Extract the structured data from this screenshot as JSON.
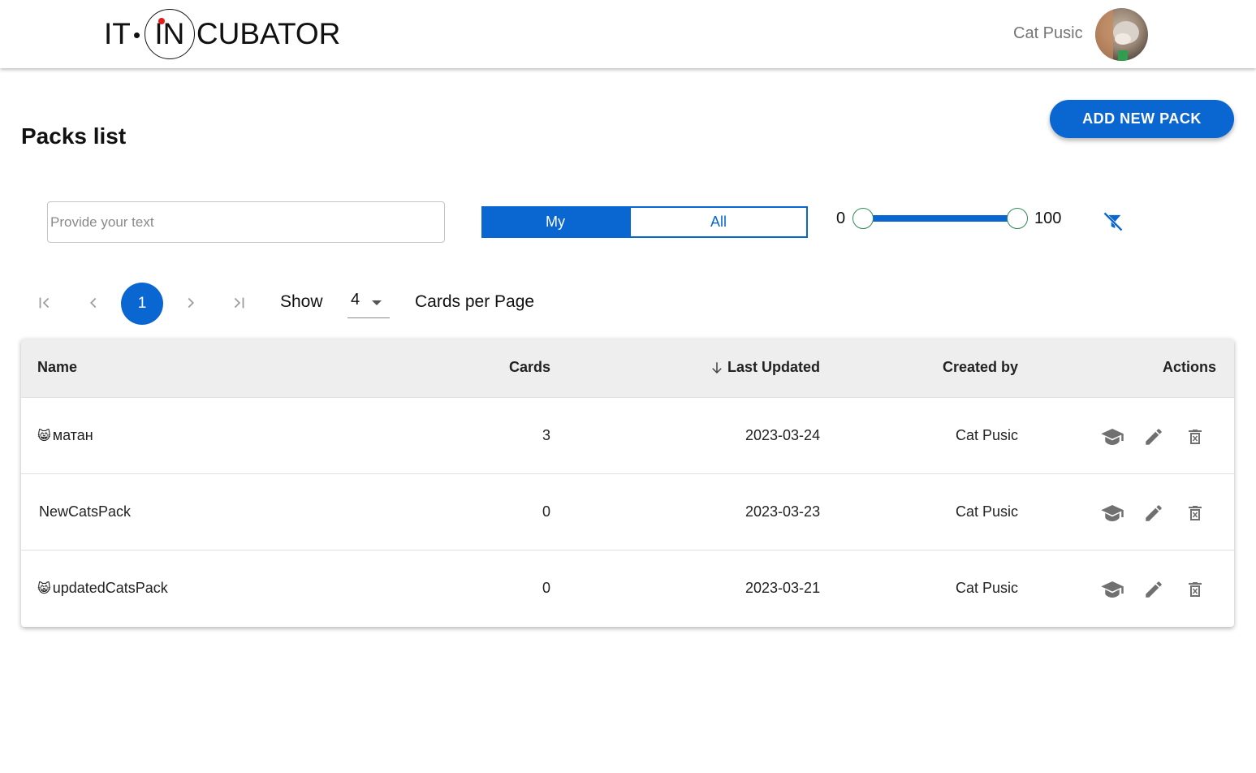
{
  "header": {
    "logo_left": "IT",
    "logo_mid": "IN",
    "logo_right": "CUBATOR",
    "user_name": "Cat Pusic"
  },
  "page": {
    "title": "Packs list",
    "add_button": "ADD NEW PACK"
  },
  "filters": {
    "search_placeholder": "Provide your text",
    "toggle_my": "My",
    "toggle_all": "All",
    "toggle_selected": "My",
    "range_min": "0",
    "range_max": "100",
    "clear_icon": "filter-off-icon"
  },
  "pagination": {
    "current_page": "1",
    "show_label": "Show",
    "per_page": "4",
    "per_page_label": "Cards per Page"
  },
  "table": {
    "columns": {
      "name": "Name",
      "cards": "Cards",
      "last_updated": "Last Updated",
      "created_by": "Created by",
      "actions": "Actions"
    },
    "rows": [
      {
        "emoji": "😸",
        "name": "матан",
        "cards": "3",
        "last_updated": "2023-03-24",
        "created_by": "Cat Pusic"
      },
      {
        "emoji": "",
        "name": "NewCatsPack",
        "cards": "0",
        "last_updated": "2023-03-23",
        "created_by": "Cat Pusic"
      },
      {
        "emoji": "😸",
        "name": "updatedCatsPack",
        "cards": "0",
        "last_updated": "2023-03-21",
        "created_by": "Cat Pusic"
      }
    ]
  },
  "colors": {
    "primary": "#0a66d1",
    "header_bg": "#eeeeee",
    "icon_gray": "#707070"
  }
}
